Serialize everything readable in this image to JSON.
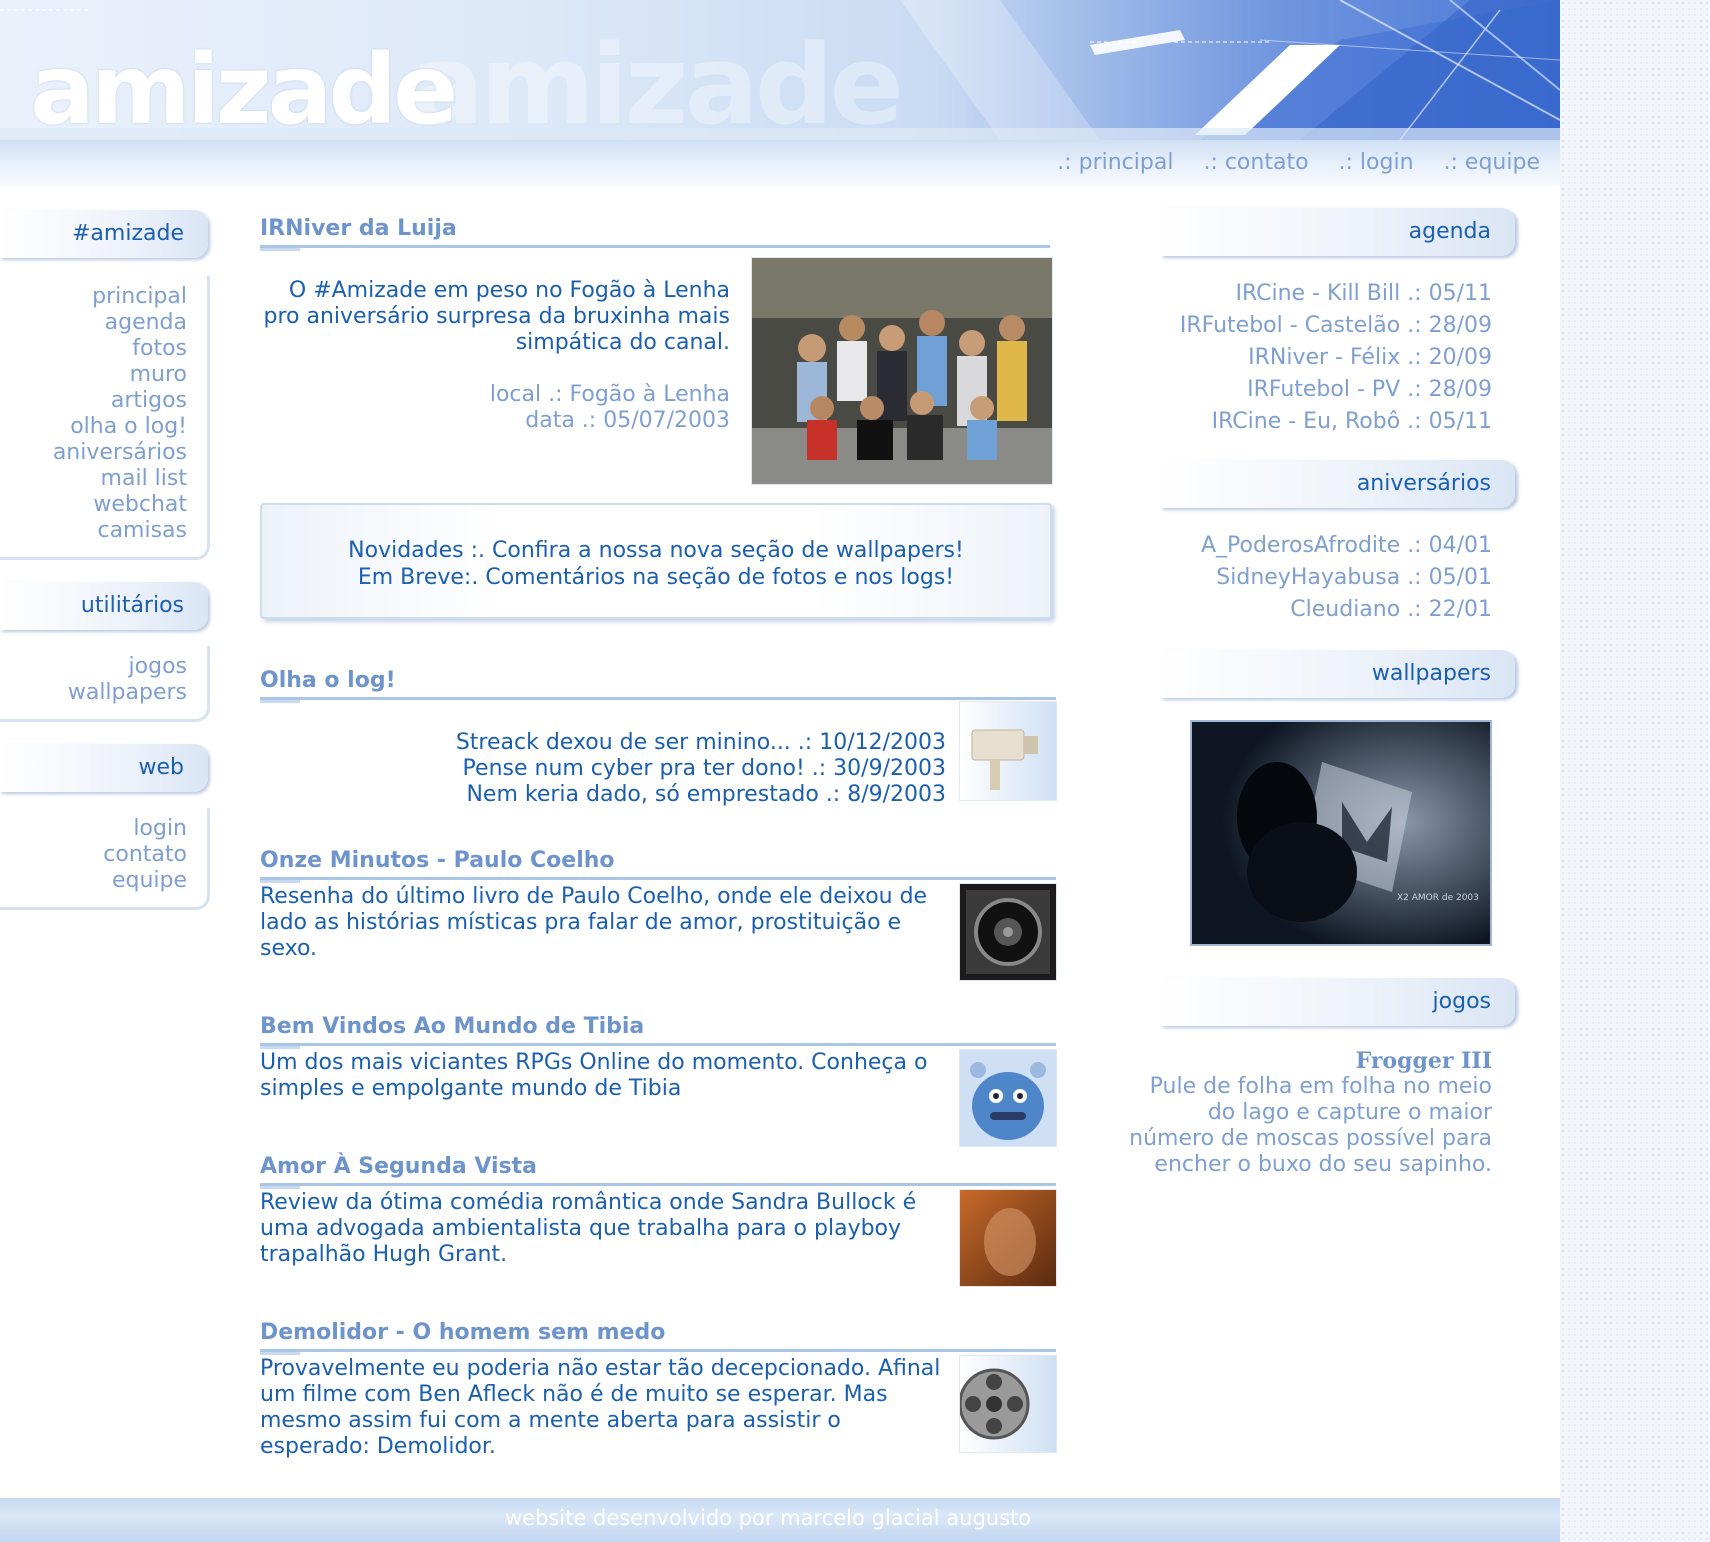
{
  "header": {
    "logo_text": "amizade"
  },
  "topnav": {
    "items": [
      ".: principal",
      ".: contato",
      ".: login",
      ".: equipe"
    ]
  },
  "left": {
    "amizade_title": "#amizade",
    "amizade_items": [
      "principal",
      "agenda",
      "fotos",
      "muro",
      "artigos",
      "olha o log!",
      "aniversários",
      "mail list",
      "webchat",
      "camisas"
    ],
    "util_title": "utilitários",
    "util_items": [
      "jogos",
      "wallpapers"
    ],
    "web_title": "web",
    "web_items": [
      "login",
      "contato",
      "equipe"
    ]
  },
  "feature": {
    "title": "IRNiver da Luija",
    "text": "O #Amizade em peso no Fogão à Lenha pro aniversário surpresa da bruxinha mais simpática do canal.",
    "local": "local .: Fogão à Lenha",
    "data": "data .: 05/07/2003"
  },
  "novidades": {
    "line1": "Novidades :. Confira a nossa nova seção de wallpapers!",
    "line2": "Em Breve:. Comentários na seção de fotos e nos logs!"
  },
  "log": {
    "title": "Olha o log!",
    "items": [
      "Streack dexou de ser minino... .: 10/12/2003",
      "Pense num cyber pra ter dono! .: 30/9/2003",
      "Nem keria dado, só emprestado .: 8/9/2003"
    ]
  },
  "articles": [
    {
      "title": "Onze Minutos - Paulo Coelho",
      "text": "Resenha do último livro de Paulo Coelho, onde ele deixou de lado as histórias místicas pra falar de amor, prostituição e sexo."
    },
    {
      "title": "Bem Vindos Ao Mundo de Tibia",
      "text": "Um dos mais viciantes RPGs Online do momento. Conheça o simples e empolgante mundo de Tibia"
    },
    {
      "title": "Amor À Segunda Vista",
      "text": "Review da ótima comédia romântica onde Sandra Bullock é uma advogada ambientalista que trabalha para o playboy trapalhão Hugh Grant."
    },
    {
      "title": "Demolidor - O homem sem medo",
      "text": "Provavelmente eu poderia não estar tão decepcionado. Afinal um filme com Ben Afleck não é de muito se esperar. Mas mesmo assim fui com a mente aberta para assistir o esperado: Demolidor."
    }
  ],
  "right": {
    "agenda_title": "agenda",
    "agenda_items": [
      "IRCine - Kill Bill .: 05/11",
      "IRFutebol - Castelão .: 28/09",
      "IRNiver - Félix .: 20/09",
      "IRFutebol - PV .: 28/09",
      "IRCine - Eu, Robô .: 05/11"
    ],
    "aniv_title": "aniversários",
    "aniv_items": [
      "A_PoderosAfrodite .: 04/01",
      "SidneyHayabusa .: 05/01",
      "Cleudiano .: 22/01"
    ],
    "wallpapers_title": "wallpapers",
    "wallpaper_caption": "X2 AMOR de 2003",
    "jogos_title": "jogos",
    "game_title": "Frogger III",
    "game_text": "Pule de folha em folha no meio do lago e capture o maior número de moscas possível para encher o buxo do seu sapinho."
  },
  "footer": {
    "credit": "website desenvolvido por marcelo glacial augusto"
  }
}
